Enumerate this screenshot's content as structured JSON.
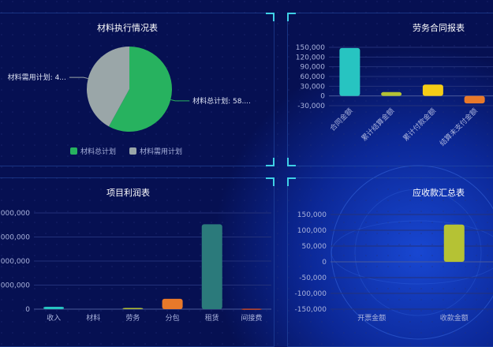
{
  "colors": {
    "background": "#061052",
    "grid": "#23317a",
    "axis_text": "#aab3dd",
    "corner_accent": "#3fd0e6"
  },
  "chart_data": [
    {
      "type": "pie",
      "title": "材料执行情况表",
      "slices": [
        {
          "name": "材料总计划",
          "label": "材料总计划: 58....",
          "value": 58,
          "color": "#27b25f"
        },
        {
          "name": "材料需用计划",
          "label": "材料需用计划: 4...",
          "value": 42,
          "color": "#9aa6a8"
        }
      ],
      "legend": {
        "position": "bottom",
        "items": [
          "材料总计划",
          "材料需用计划"
        ]
      }
    },
    {
      "type": "bar",
      "title": "劳务合同报表",
      "categories": [
        "合同金额",
        "累计结算金额",
        "累计付款金额",
        "结算未支付金额"
      ],
      "values": [
        148000,
        12000,
        35000,
        -23000
      ],
      "colors": [
        "#27c4c1",
        "#b5c234",
        "#f5cc16",
        "#e8792a"
      ],
      "ylim": [
        -30000,
        150000
      ],
      "yticks": [
        -30000,
        0,
        30000,
        60000,
        90000,
        120000,
        150000
      ],
      "ytick_labels": [
        "-30,000",
        "0",
        "30,000",
        "60,000",
        "90,000",
        "120,000",
        "150,000"
      ],
      "grid": true
    },
    {
      "type": "bar",
      "title": "项目利润表",
      "categories": [
        "收入",
        "材料",
        "劳务",
        "分包",
        "租赁",
        "间接费"
      ],
      "values": [
        100000,
        0,
        50000,
        430000,
        3530000,
        20000
      ],
      "colors": [
        "#27c4c1",
        "#27b25f",
        "#b5c234",
        "#e8792a",
        "#2b7a7b",
        "#c34a2a"
      ],
      "ylim": [
        0,
        4000000
      ],
      "yticks": [
        0,
        1000000,
        2000000,
        3000000,
        4000000
      ],
      "ytick_labels": [
        "0",
        ",000,000",
        ",000,000",
        ",000,000",
        ",000,000"
      ],
      "grid": true
    },
    {
      "type": "bar",
      "title": "应收款汇总表",
      "categories": [
        "开票金额",
        "收款金额"
      ],
      "values": [
        0,
        118000
      ],
      "colors": [
        "#27c4c1",
        "#b5c234"
      ],
      "ylim": [
        -150000,
        150000
      ],
      "yticks": [
        -150000,
        -100000,
        -50000,
        0,
        50000,
        100000,
        150000
      ],
      "ytick_labels": [
        "-150,000",
        "-100,000",
        "-50,000",
        "0",
        "50,000",
        "100,000",
        "150,000"
      ],
      "grid": true
    }
  ]
}
